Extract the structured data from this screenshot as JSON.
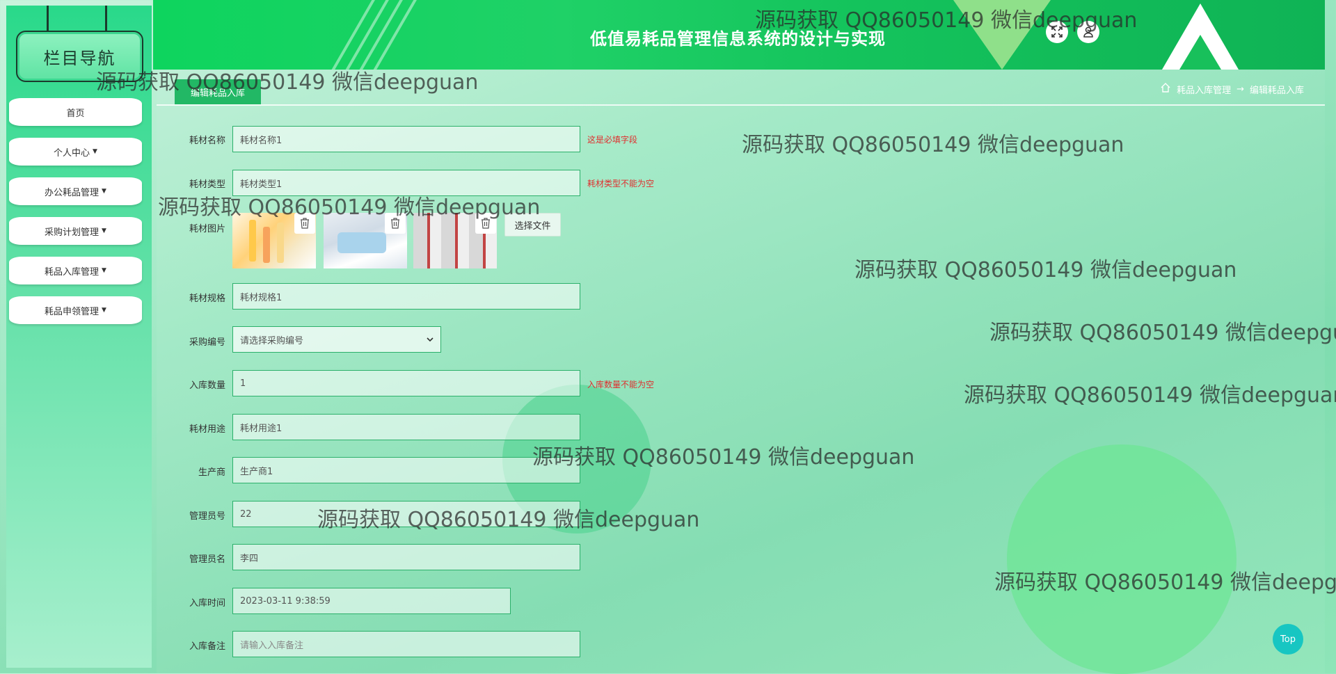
{
  "header": {
    "title": "低值易耗品管理信息系统的设计与实现",
    "fullscreen_icon": "expand-icon",
    "user_icon": "user-icon"
  },
  "sidebar": {
    "title": "栏目导航",
    "items": [
      {
        "label": "首页",
        "dropdown": false
      },
      {
        "label": "个人中心",
        "dropdown": true
      },
      {
        "label": "办公耗品管理",
        "dropdown": true
      },
      {
        "label": "采购计划管理",
        "dropdown": true
      },
      {
        "label": "耗品入库管理",
        "dropdown": true
      },
      {
        "label": "耗品申领管理",
        "dropdown": true
      }
    ]
  },
  "tabs": {
    "active": "编辑耗品入库"
  },
  "breadcrumb": {
    "home_icon": "home-icon",
    "parent": "耗品入库管理",
    "separator": "→",
    "current": "编辑耗品入库"
  },
  "form": {
    "name_label": "耗材名称",
    "name_value": "耗材名称1",
    "name_error": "这是必填字段",
    "type_label": "耗材类型",
    "type_value": "耗材类型1",
    "type_error": "耗材类型不能为空",
    "image_label": "耗材图片",
    "choose_file": "选择文件",
    "spec_label": "耗材规格",
    "spec_value": "耗材规格1",
    "purchase_label": "采购编号",
    "purchase_placeholder": "请选择采购编号",
    "qty_label": "入库数量",
    "qty_value": "1",
    "qty_error": "入库数量不能为空",
    "usage_label": "耗材用途",
    "usage_value": "耗材用途1",
    "maker_label": "生产商",
    "maker_value": "生产商1",
    "admin_no_label": "管理员号",
    "admin_no_value": "22",
    "admin_name_label": "管理员名",
    "admin_name_value": "李四",
    "time_label": "入库时间",
    "time_value": "2023-03-11 9:38:59",
    "remark_label": "入库备注",
    "remark_placeholder": "请输入入库备注"
  },
  "watermark_text": "源码获取 QQ86050149 微信deepguan",
  "top_button": "Top",
  "colors": {
    "header_green": "#14c35c",
    "accent": "#22b865",
    "error": "#e02d2d",
    "top_button": "#17c6c2"
  }
}
